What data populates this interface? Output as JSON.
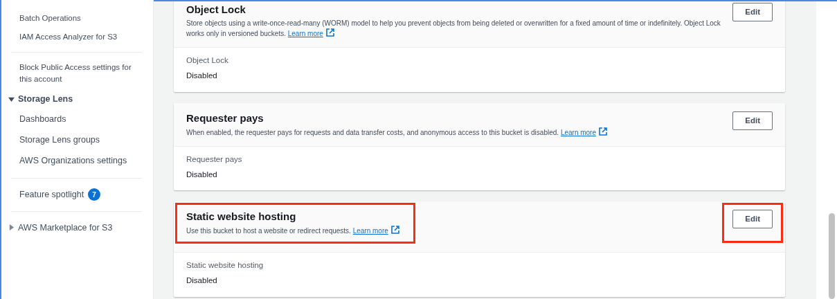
{
  "sidebar": {
    "groups": [
      {
        "items": [
          {
            "kind": "link",
            "label": "Batch Operations"
          },
          {
            "kind": "link",
            "label": "IAM Access Analyzer for S3"
          }
        ]
      },
      {
        "items": [
          {
            "kind": "link",
            "label": "Block Public Access settings for this account"
          },
          {
            "kind": "section",
            "label": "Storage Lens",
            "expanded": true,
            "children": [
              {
                "label": "Dashboards"
              },
              {
                "label": "Storage Lens groups"
              },
              {
                "label": "AWS Organizations settings"
              }
            ]
          }
        ]
      },
      {
        "items": [
          {
            "kind": "badge",
            "label": "Feature spotlight",
            "badge": "7"
          }
        ]
      },
      {
        "items": [
          {
            "kind": "section",
            "label": "AWS Marketplace for S3",
            "expanded": false
          }
        ]
      }
    ]
  },
  "cards": [
    {
      "title": "Object Lock",
      "description": "Store objects using a write-once-read-many (WORM) model to help you prevent objects from being deleted or overwritten for a fixed amount of time or indefinitely. Object Lock works only in versioned buckets.",
      "link": "Learn more",
      "button": "Edit",
      "highlighted": false,
      "field_label": "Object Lock",
      "field_value": "Disabled"
    },
    {
      "title": "Requester pays",
      "description": "When enabled, the requester pays for requests and data transfer costs, and anonymous access to this bucket is disabled.",
      "link": "Learn more",
      "button": "Edit",
      "highlighted": false,
      "field_label": "Requester pays",
      "field_value": "Disabled"
    },
    {
      "title": "Static website hosting",
      "description": "Use this bucket to host a website or redirect requests.",
      "link": "Learn more",
      "button": "Edit",
      "highlighted": true,
      "field_label": "Static website hosting",
      "field_value": "Disabled"
    }
  ]
}
